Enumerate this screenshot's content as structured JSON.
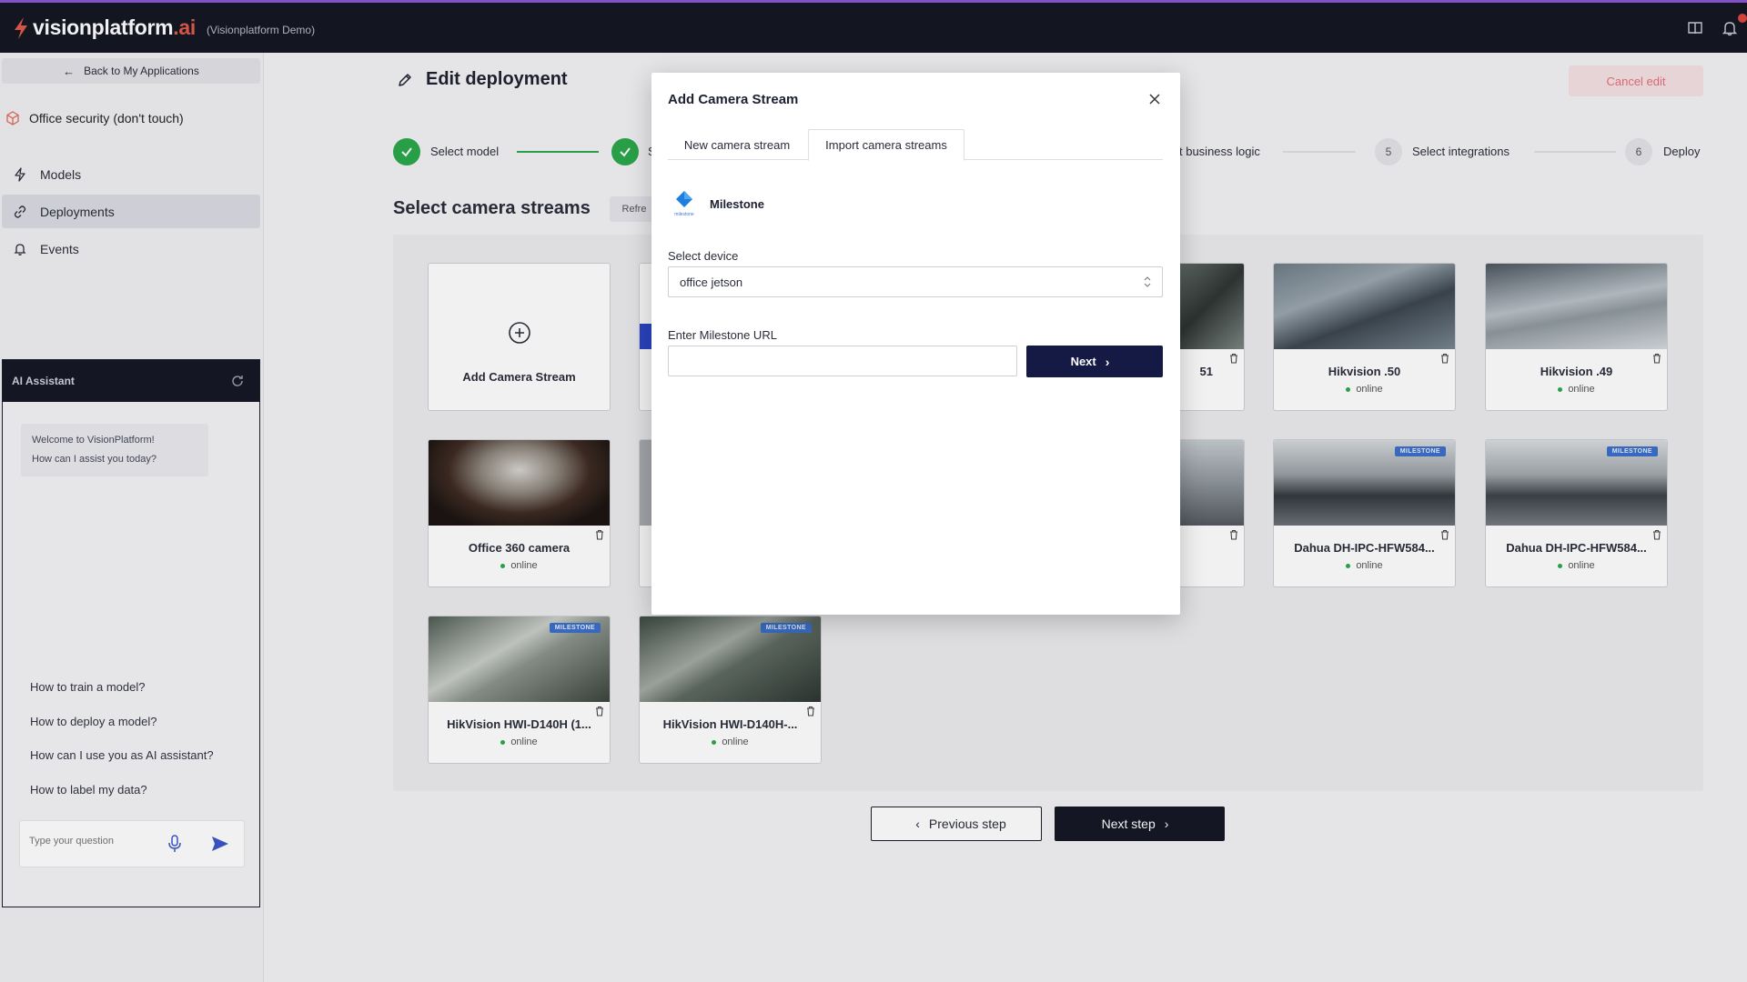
{
  "brand": {
    "name": "visionplatform",
    "suffix": ".ai",
    "subtitle": "(Visionplatform Demo)"
  },
  "sidebar": {
    "back_label": "Back to My Applications",
    "app_name": "Office security (don't touch)",
    "nav": [
      {
        "label": "Models",
        "icon": "lightning-icon",
        "active": false
      },
      {
        "label": "Deployments",
        "icon": "link-icon",
        "active": true
      },
      {
        "label": "Events",
        "icon": "bell-icon",
        "active": false
      }
    ]
  },
  "assistant": {
    "title": "AI Assistant",
    "welcome_line1": "Welcome to VisionPlatform!",
    "welcome_line2": "How can I assist you today?",
    "suggestions": [
      "How to train a model?",
      "How to deploy a model?",
      "How can I use you as AI assistant?",
      "How to label my data?"
    ],
    "input_placeholder": "Type your question"
  },
  "header": {
    "title": "Edit deployment",
    "cancel_label": "Cancel edit"
  },
  "stepper": {
    "step1_label": "Select model",
    "step2_label": "S",
    "step4_label": "t business logic",
    "step5_num": "5",
    "step5_label": "Select integrations",
    "step6_num": "6",
    "step6_label": "Deploy"
  },
  "section": {
    "title": "Select camera streams",
    "refresh_label": "Refre"
  },
  "cards": {
    "add_label": "Add Camera Stream",
    "badge": "MILESTONE",
    "items": [
      {
        "name": "51",
        "status": "online"
      },
      {
        "name": "Hikvision .50",
        "status": "online"
      },
      {
        "name": "Hikvision .49",
        "status": "online"
      },
      {
        "name": "Office 360 camera",
        "status": "online"
      },
      {
        "name": "Dahua DH-IPC-HFW584...",
        "status": "online"
      },
      {
        "name": "Dahua DH-IPC-HFW584...",
        "status": "online"
      },
      {
        "name": "HikVision HWI-D140H (1...",
        "status": "online"
      },
      {
        "name": "HikVision HWI-D140H-...",
        "status": "online"
      }
    ]
  },
  "footer": {
    "prev_label": "Previous step",
    "next_label": "Next step"
  },
  "modal": {
    "title": "Add Camera Stream",
    "tabs": [
      "New camera stream",
      "Import camera streams"
    ],
    "active_tab": 1,
    "provider_name": "Milestone",
    "provider_logo_caption": "milestone",
    "device_label": "Select device",
    "device_value": "office jetson",
    "url_label": "Enter Milestone URL",
    "url_value": "",
    "next_label": "Next"
  },
  "colors": {
    "topbar": "#141623",
    "accent_purple": "#8a55d6",
    "success": "#2aa84a",
    "primary_button": "#151a45",
    "cancel_text": "#e4707a"
  }
}
